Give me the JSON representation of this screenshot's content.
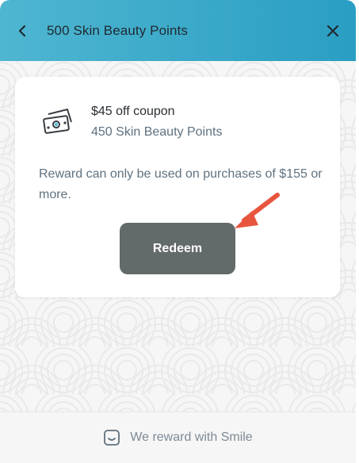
{
  "header": {
    "title": "500 Skin Beauty Points",
    "back_icon": "chevron-left-icon",
    "close_icon": "close-icon",
    "gradient_start": "#4fb6d1",
    "gradient_end": "#2a9ec3"
  },
  "reward": {
    "icon": "money-bills-icon",
    "title": "$45 off coupon",
    "points": "450 Skin Beauty Points",
    "description": "Reward can only be used on purchases of $155 or more.",
    "redeem_label": "Redeem",
    "button_color": "#636a6a"
  },
  "annotation": {
    "arrow_color": "#e8553f"
  },
  "footer": {
    "icon": "smile-icon",
    "text": "We reward with Smile"
  }
}
